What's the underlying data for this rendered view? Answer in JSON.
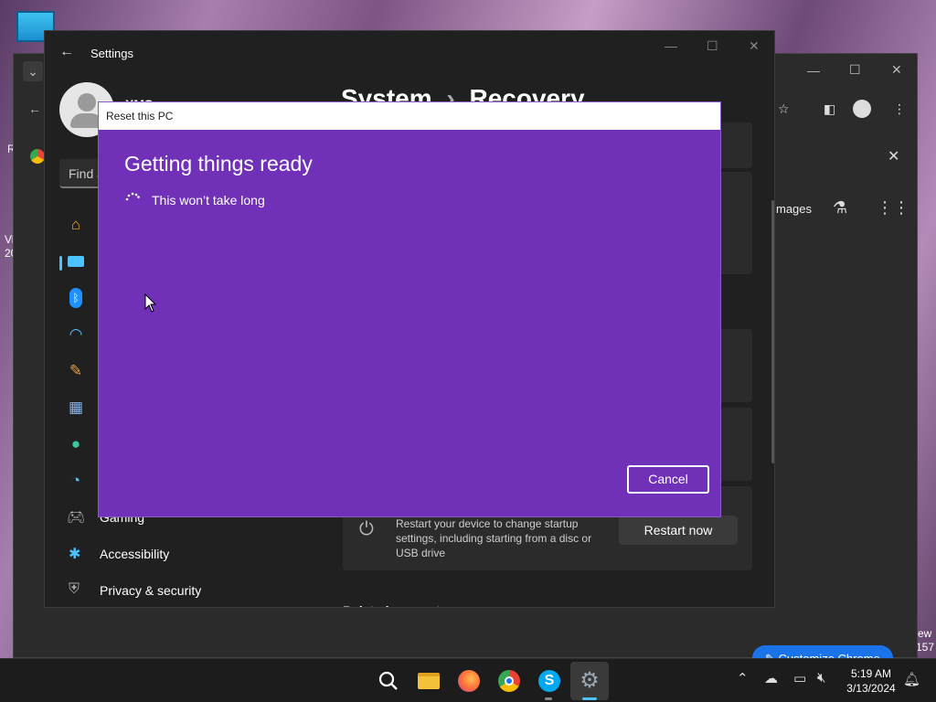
{
  "desktop": {
    "partial_texts": [
      "R",
      "Vi",
      "20",
      "ew",
      "157"
    ]
  },
  "chrome": {
    "customize_label": "Customize Chrome",
    "find_label": "Find a",
    "images_label": "mages"
  },
  "settings": {
    "app_title": "Settings",
    "user_name": "XMS",
    "breadcrumb_parent": "System",
    "breadcrumb_sep": "›",
    "breadcrumb_current": "Recovery",
    "nav": {
      "gaming": "Gaming",
      "accessibility": "Accessibility",
      "privacy": "Privacy & security"
    },
    "advanced_startup": {
      "description": "Restart your device to change startup settings, including starting from a disc or USB drive",
      "button_label": "Restart now"
    },
    "related_partial": "Related support"
  },
  "dialog": {
    "window_title": "Reset this PC",
    "heading": "Getting things ready",
    "subtext": "This won’t take long",
    "cancel_label": "Cancel",
    "accent_color": "#7030b8"
  },
  "taskbar": {
    "time": "5:19 AM",
    "date": "3/13/2024",
    "apps": [
      "search-icon",
      "file-explorer-icon",
      "firefox-icon",
      "chrome-icon",
      "skype-icon",
      "settings-gear-icon"
    ]
  }
}
